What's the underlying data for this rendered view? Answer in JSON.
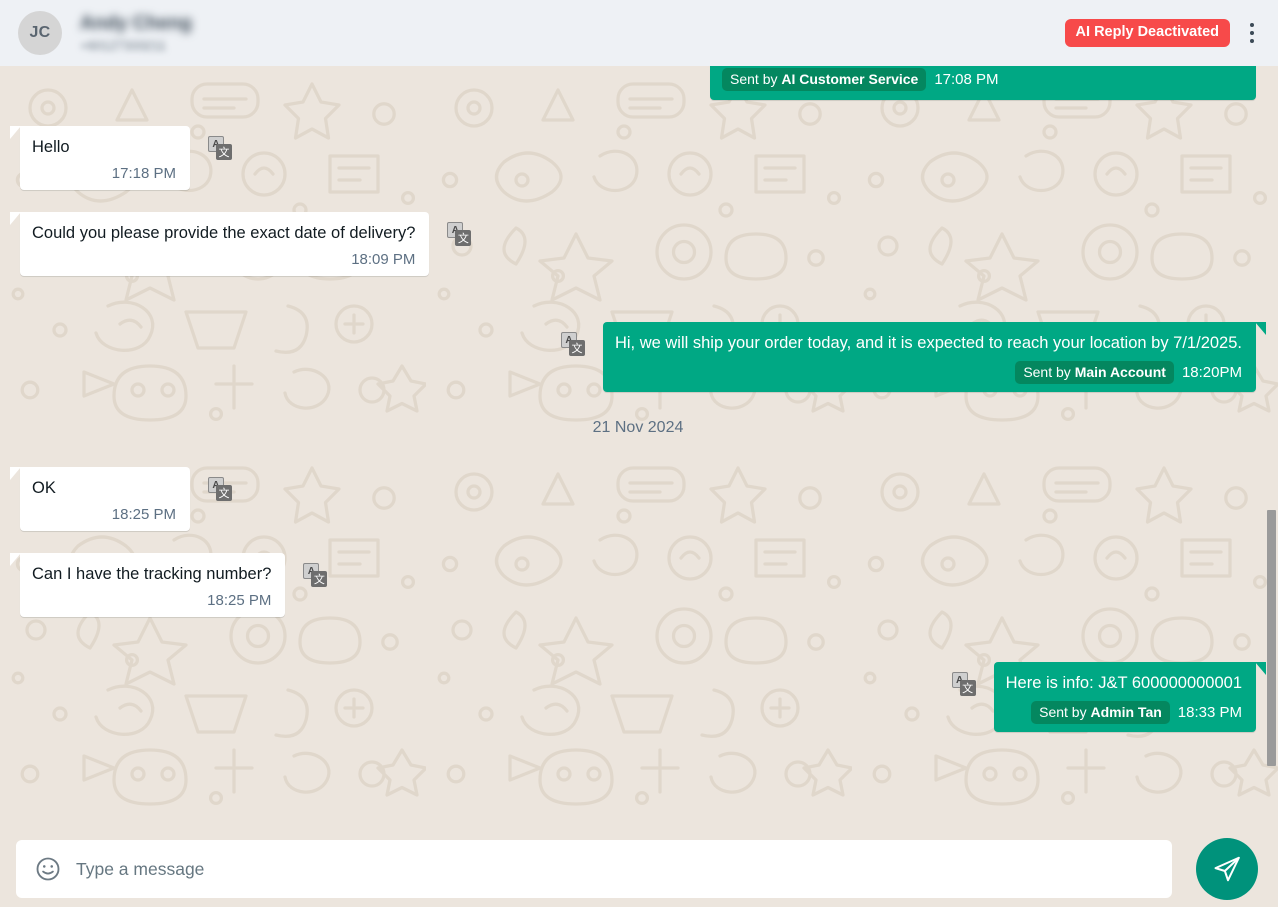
{
  "header": {
    "avatar_initials": "JC",
    "contact_name": "Andy Cheng",
    "contact_phone": "+60127333211",
    "ai_status_badge": "AI Reply Deactivated",
    "menu_icon": "kebab-menu-icon"
  },
  "messages": [
    {
      "id": "m0",
      "direction": "out",
      "cut_off": true,
      "text": "",
      "sender_prefix": "Sent by ",
      "sender_name": "AI Customer Service",
      "time": "17:08 PM",
      "has_translate_icon": true
    },
    {
      "id": "m1",
      "direction": "in",
      "text": "Hello",
      "time": "17:18 PM",
      "has_translate_icon": true
    },
    {
      "id": "m2",
      "direction": "in",
      "text": "Could you please provide the exact date of delivery?",
      "time": "18:09 PM",
      "has_translate_icon": true
    },
    {
      "id": "m3",
      "direction": "out",
      "text": "Hi, we will ship your order today, and it is expected to reach your location by 7/1/2025.",
      "sender_prefix": "Sent by ",
      "sender_name": "Main Account",
      "time": "18:20PM",
      "has_translate_icon": true
    },
    {
      "id": "d1",
      "direction": "divider",
      "text": "21 Nov 2024"
    },
    {
      "id": "m4",
      "direction": "in",
      "text": "OK",
      "time": "18:25 PM",
      "has_translate_icon": true
    },
    {
      "id": "m5",
      "direction": "in",
      "text": "Can I have the tracking number?",
      "time": "18:25 PM",
      "has_translate_icon": true
    },
    {
      "id": "m6",
      "direction": "out",
      "text": "Here is info: J&T 600000000001",
      "sender_prefix": "Sent by ",
      "sender_name": "Admin Tan",
      "time": "18:33 PM",
      "has_translate_icon": true
    }
  ],
  "translate_icon": {
    "latin_glyph": "A",
    "cjk_glyph": "文",
    "name": "translate-icon"
  },
  "footer": {
    "emoji_icon": "smiley-emoji-icon",
    "input_value": "",
    "input_placeholder": "Type a message",
    "send_icon": "send-paper-plane-icon"
  },
  "colors": {
    "outgoing_bubble": "#00a884",
    "incoming_bubble": "#ffffff",
    "chat_background": "#ece5dd",
    "header_background": "#eef1f5",
    "badge_red": "#f74a4a",
    "send_button": "#00927b",
    "sender_chip": "#04875f"
  }
}
